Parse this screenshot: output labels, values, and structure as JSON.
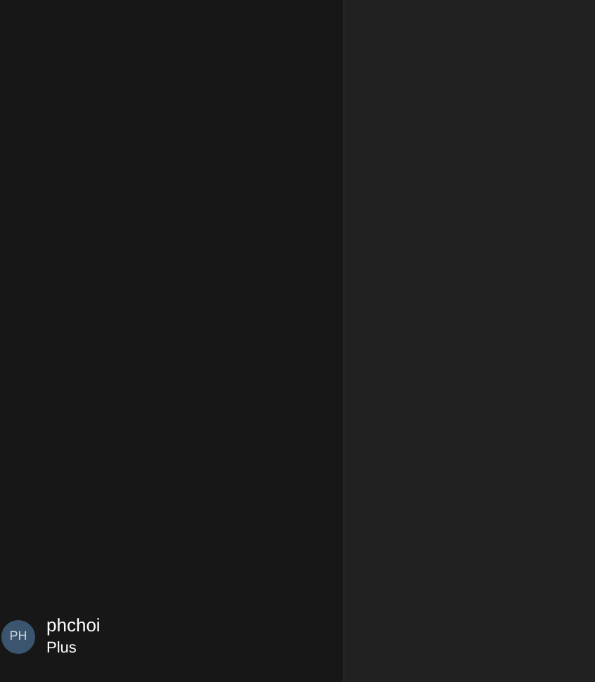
{
  "user": {
    "initials": "PH",
    "name": "phchoi",
    "plan": "Plus"
  }
}
